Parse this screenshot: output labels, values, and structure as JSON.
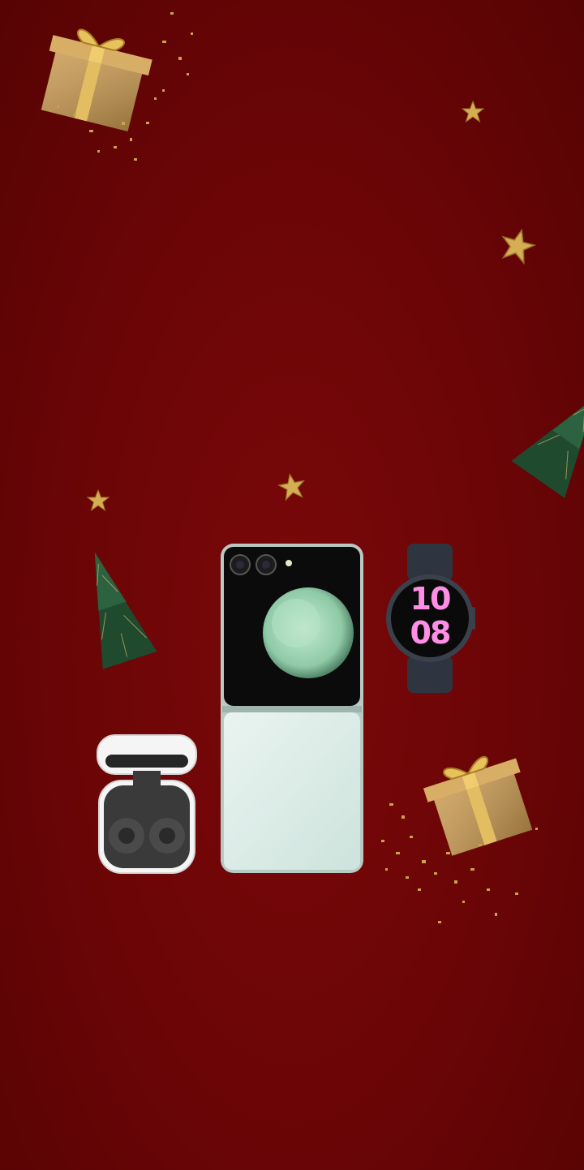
{
  "scene": {
    "background_color": "#6b0506",
    "accent_gold": "#c9a24a",
    "tree_green": "#1f4a2e"
  },
  "products": {
    "phone": {
      "icon": "flip-phone-icon",
      "cover_color": "#0b0b0b",
      "body_color": "#dfeee9",
      "disc_color": "#9ad3b0"
    },
    "watch": {
      "icon": "smartwatch-icon",
      "face_color": "#ff8ee6",
      "time_top": "10",
      "time_bottom": "08"
    },
    "earbuds": {
      "icon": "earbuds-case-icon",
      "case_color": "#f5f5f5"
    }
  },
  "decorations": [
    {
      "icon": "gift-box-icon"
    },
    {
      "icon": "gold-star-icon"
    },
    {
      "icon": "christmas-tree-icon"
    }
  ]
}
